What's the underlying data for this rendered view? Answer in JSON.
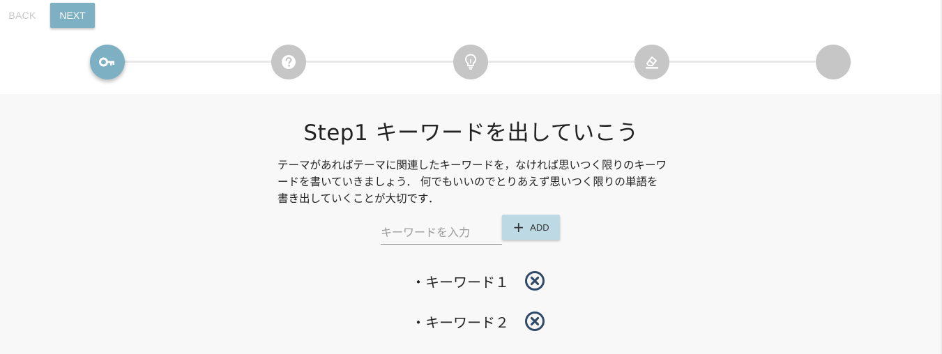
{
  "nav": {
    "back_label": "BACK",
    "next_label": "NEXT"
  },
  "colors": {
    "accent": "#7eb0c4",
    "add_button": "#bcd9e4",
    "inactive_step": "#c6c6c6",
    "remove_icon": "#2f4a66"
  },
  "stepper": {
    "steps": [
      {
        "icon": "key-icon",
        "active": true
      },
      {
        "icon": "help-circle-icon",
        "active": false
      },
      {
        "icon": "lightbulb-icon",
        "active": false
      },
      {
        "icon": "eraser-icon",
        "active": false
      },
      {
        "icon": "blank-icon",
        "active": false
      }
    ]
  },
  "main": {
    "title": "Step1 キーワードを出していこう",
    "description": "テーマがあればテーマに関連したキーワードを，なければ思いつく限りのキーワードを書いていきましょう． 何でもいいのでとりあえず思いつく限りの単語を書き出していくことが大切です．",
    "input_placeholder": "キーワードを入力",
    "add_icon": "plus-icon",
    "add_label": "ADD",
    "bullet": "・",
    "keywords": [
      "キーワード１",
      "キーワード２"
    ],
    "remove_icon": "close-circle-icon"
  }
}
